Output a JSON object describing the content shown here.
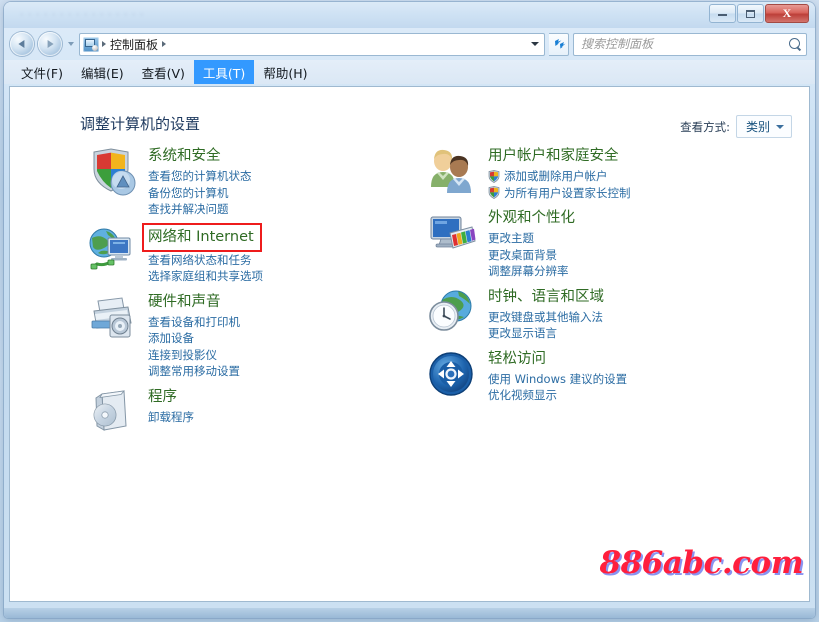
{
  "window": {
    "title_ghost": "· ·  ·  ·  ·  ·  ·  ·  ·  ·  ·  ·  ·  ·  ·  ·",
    "minimize_label": "—",
    "maximize_label": "□",
    "close_label": "X"
  },
  "addressbar": {
    "back_label": "◀",
    "forward_label": "▶",
    "history_label": "▾",
    "breadcrumb": "控制面板",
    "dropdown_label": "▾",
    "refresh_label": "↯"
  },
  "search": {
    "placeholder": "搜索控制面板",
    "value": ""
  },
  "menu": {
    "items": [
      {
        "label": "文件(F)",
        "active": false
      },
      {
        "label": "编辑(E)",
        "active": false
      },
      {
        "label": "查看(V)",
        "active": false
      },
      {
        "label": "工具(T)",
        "active": true
      },
      {
        "label": "帮助(H)",
        "active": false
      }
    ]
  },
  "main": {
    "page_title": "调整计算机的设置",
    "view_by_label": "查看方式:",
    "view_by_value": "类别",
    "categories_left": [
      {
        "title": "系统和安全",
        "icon": "security-shield-icon",
        "highlighted": false,
        "links": [
          {
            "label": "查看您的计算机状态",
            "shield": false
          },
          {
            "label": "备份您的计算机",
            "shield": false
          },
          {
            "label": "查找并解决问题",
            "shield": false
          }
        ]
      },
      {
        "title": "网络和 Internet",
        "icon": "network-globe-icon",
        "highlighted": true,
        "links": [
          {
            "label": "查看网络状态和任务",
            "shield": false
          },
          {
            "label": "选择家庭组和共享选项",
            "shield": false
          }
        ]
      },
      {
        "title": "硬件和声音",
        "icon": "printer-speaker-icon",
        "highlighted": false,
        "links": [
          {
            "label": "查看设备和打印机",
            "shield": false
          },
          {
            "label": "添加设备",
            "shield": false
          },
          {
            "label": "连接到投影仪",
            "shield": false
          },
          {
            "label": "调整常用移动设置",
            "shield": false
          }
        ]
      },
      {
        "title": "程序",
        "icon": "software-box-icon",
        "highlighted": false,
        "links": [
          {
            "label": "卸载程序",
            "shield": false
          }
        ]
      }
    ],
    "categories_right": [
      {
        "title": "用户帐户和家庭安全",
        "icon": "users-icon",
        "highlighted": false,
        "links": [
          {
            "label": "添加或删除用户帐户",
            "shield": true
          },
          {
            "label": "为所有用户设置家长控制",
            "shield": true
          }
        ]
      },
      {
        "title": "外观和个性化",
        "icon": "display-palette-icon",
        "highlighted": false,
        "links": [
          {
            "label": "更改主题",
            "shield": false
          },
          {
            "label": "更改桌面背景",
            "shield": false
          },
          {
            "label": "调整屏幕分辨率",
            "shield": false
          }
        ]
      },
      {
        "title": "时钟、语言和区域",
        "icon": "clock-globe-icon",
        "highlighted": false,
        "links": [
          {
            "label": "更改键盘或其他输入法",
            "shield": false
          },
          {
            "label": "更改显示语言",
            "shield": false
          }
        ]
      },
      {
        "title": "轻松访问",
        "icon": "ease-of-access-icon",
        "highlighted": false,
        "links": [
          {
            "label": "使用 Windows 建议的设置",
            "shield": false
          },
          {
            "label": "优化视频显示",
            "shield": false
          }
        ]
      }
    ]
  },
  "watermark": {
    "text": "886abc.com"
  },
  "colors": {
    "category_title": "#2f6b24",
    "link": "#2b6ca3",
    "highlight_box": "#ee1c1c",
    "menu_active": "#3399ff",
    "watermark": "#ff1f3d"
  }
}
